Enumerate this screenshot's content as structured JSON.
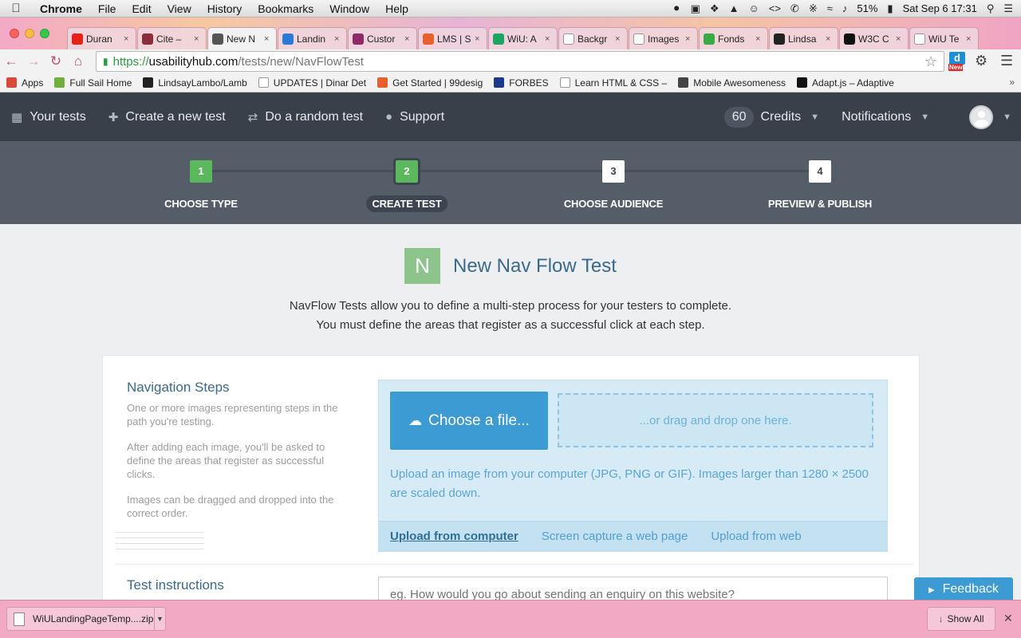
{
  "os_menu": {
    "app": "Chrome",
    "items": [
      "File",
      "Edit",
      "View",
      "History",
      "Bookmarks",
      "Window",
      "Help"
    ],
    "battery": "51%",
    "datetime": "Sat Sep 6  17:31"
  },
  "tabs": [
    {
      "label": "Duran",
      "fav_color": "#e62117",
      "active": false
    },
    {
      "label": "Cite –",
      "fav_color": "#8a2c3c",
      "active": false
    },
    {
      "label": "New N",
      "fav_color": "#555555",
      "active": true
    },
    {
      "label": "Landin",
      "fav_color": "#2b7bd6",
      "active": false
    },
    {
      "label": "Custor",
      "fav_color": "#8e2a6a",
      "active": false
    },
    {
      "label": "LMS | S",
      "fav_color": "#e8602c",
      "active": false
    },
    {
      "label": "WiU: A",
      "fav_color": "#1fa463",
      "active": false
    },
    {
      "label": "Backgr",
      "fav_color": "#ffffff",
      "active": false
    },
    {
      "label": "Images",
      "fav_color": "#ffffff",
      "active": false
    },
    {
      "label": "Fonds",
      "fav_color": "#3aaa45",
      "active": false
    },
    {
      "label": "Lindsa",
      "fav_color": "#222222",
      "active": false
    },
    {
      "label": "W3C C",
      "fav_color": "#111111",
      "active": false
    },
    {
      "label": "WiU Te",
      "fav_color": "#ffffff",
      "active": false
    }
  ],
  "address": {
    "scheme": "https://",
    "host": "usabilityhub.com",
    "path": "/tests/new/NavFlowTest"
  },
  "extension_badge": {
    "letter": "d",
    "tag": "New"
  },
  "bookmarks": [
    {
      "label": "Apps",
      "icon_color": "#d84a3a"
    },
    {
      "label": "Full Sail Home",
      "icon_color": "#6fb13c"
    },
    {
      "label": "LindsayLambo/Lamb",
      "icon_color": "#222222"
    },
    {
      "label": "UPDATES | Dinar Det",
      "icon_color": "page"
    },
    {
      "label": "Get Started | 99desig",
      "icon_color": "#e8602c"
    },
    {
      "label": "FORBES",
      "icon_color": "#1a3a8a"
    },
    {
      "label": "Learn HTML & CSS –",
      "icon_color": "page"
    },
    {
      "label": "Mobile Awesomeness",
      "icon_color": "#444444"
    },
    {
      "label": "Adapt.js – Adaptive",
      "icon_color": "#111111"
    }
  ],
  "app_nav": {
    "your_tests": "Your tests",
    "create": "Create a new test",
    "random": "Do a random test",
    "support": "Support",
    "credits_count": "60",
    "credits_label": "Credits",
    "notifications": "Notifications"
  },
  "steps": [
    {
      "num": "1",
      "label": "CHOOSE TYPE",
      "state": "done"
    },
    {
      "num": "2",
      "label": "CREATE TEST",
      "state": "current"
    },
    {
      "num": "3",
      "label": "CHOOSE AUDIENCE",
      "state": "todo"
    },
    {
      "num": "4",
      "label": "PREVIEW & PUBLISH",
      "state": "todo"
    }
  ],
  "page": {
    "letter": "N",
    "title": "New Nav Flow Test",
    "intro_line1": "NavFlow Tests allow you to define a multi-step process for your testers to complete.",
    "intro_line2": "You must define the areas that register as a successful click at each step."
  },
  "nav_steps": {
    "title": "Navigation Steps",
    "p1": "One or more images representing steps in the path you're testing.",
    "p2": "After adding each image, you'll be asked to define the areas that register as successful clicks.",
    "p3": "Images can be dragged and dropped into the correct order."
  },
  "upload": {
    "choose_label": "Choose a file...",
    "drop_label": "...or drag and drop one here.",
    "help": "Upload an image from your computer (JPG, PNG or GIF). Images larger than 1280 × 2500 are scaled down.",
    "tab_computer": "Upload from computer",
    "tab_capture": "Screen capture a web page",
    "tab_web": "Upload from web"
  },
  "instructions": {
    "title": "Test instructions",
    "placeholder": "eg. How would you go about sending an enquiry on this website?"
  },
  "feedback_label": "Feedback",
  "download": {
    "file": "WiULandingPageTemp....zip",
    "show_all": "Show All"
  }
}
